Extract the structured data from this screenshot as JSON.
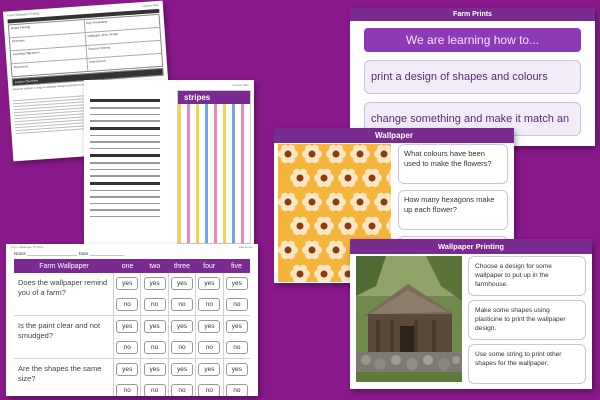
{
  "doc": {
    "header_left": "Farm Wallpaper Printing",
    "header_right": "Lesson Plan",
    "rows": [
      [
        "Board Printing",
        "Key Vocabulary"
      ],
      [
        "Overview",
        "wallpaper, print, design"
      ],
      [
        "Learning Objectives",
        "Success Criteria"
      ],
      [
        "Resources",
        "Assessment"
      ]
    ],
    "bar1": "Lesson Overview",
    "para": "Show the children a range of wallpaper designs and discuss the shapes, colours and patterns they can see."
  },
  "stripes": {
    "header": "Lesson Plan",
    "label": "stripes",
    "stripe_colors": [
      "#f5d34a",
      "#e78bb5",
      "#f5d34a",
      "#6fa7e0",
      "#e78bb5",
      "#f5d34a",
      "#6fa7e0",
      "#e78bb5"
    ]
  },
  "prints": {
    "title": "Farm Prints",
    "learning": "We are learning how to...",
    "items": [
      "print a design of shapes and colours",
      "change something and make it match an"
    ]
  },
  "wallpaper": {
    "title": "Wallpaper",
    "questions": [
      "What colours have been used to make the flowers?",
      "How many hexagons make up each flower?",
      ""
    ],
    "pattern_colors": {
      "background": "#f5b43c",
      "petal": "#fbe6c4",
      "center": "#8a3d12"
    }
  },
  "table": {
    "meta_left": "Farm Wallpaper Printing",
    "meta_right": "Classroom",
    "name_label": "Name",
    "date_label": "Date",
    "header": {
      "question_col": "Farm Wallpaper",
      "columns": [
        "one",
        "two",
        "three",
        "four",
        "five"
      ]
    },
    "questions": [
      {
        "text": "Does the wallpaper remind you of a farm?",
        "yes": "yes",
        "no": "no"
      },
      {
        "text": "Is the paint clear and not smudged?",
        "yes": "yes",
        "no": "no"
      },
      {
        "text": "Are the shapes the same size?",
        "yes": "yes",
        "no": "no"
      }
    ]
  },
  "printing": {
    "title": "Wallpaper Printing",
    "instructions": [
      "Choose a design for some wallpaper to put up in the farmhouse.",
      "Make some shapes using plasticine to print the wallpaper design.",
      "Use some string to print other shapes for the wallpaper."
    ]
  },
  "colors": {
    "background": "#8a1a8c",
    "accent": "#7a2b8f",
    "learning_box": "#8d3ab7"
  }
}
